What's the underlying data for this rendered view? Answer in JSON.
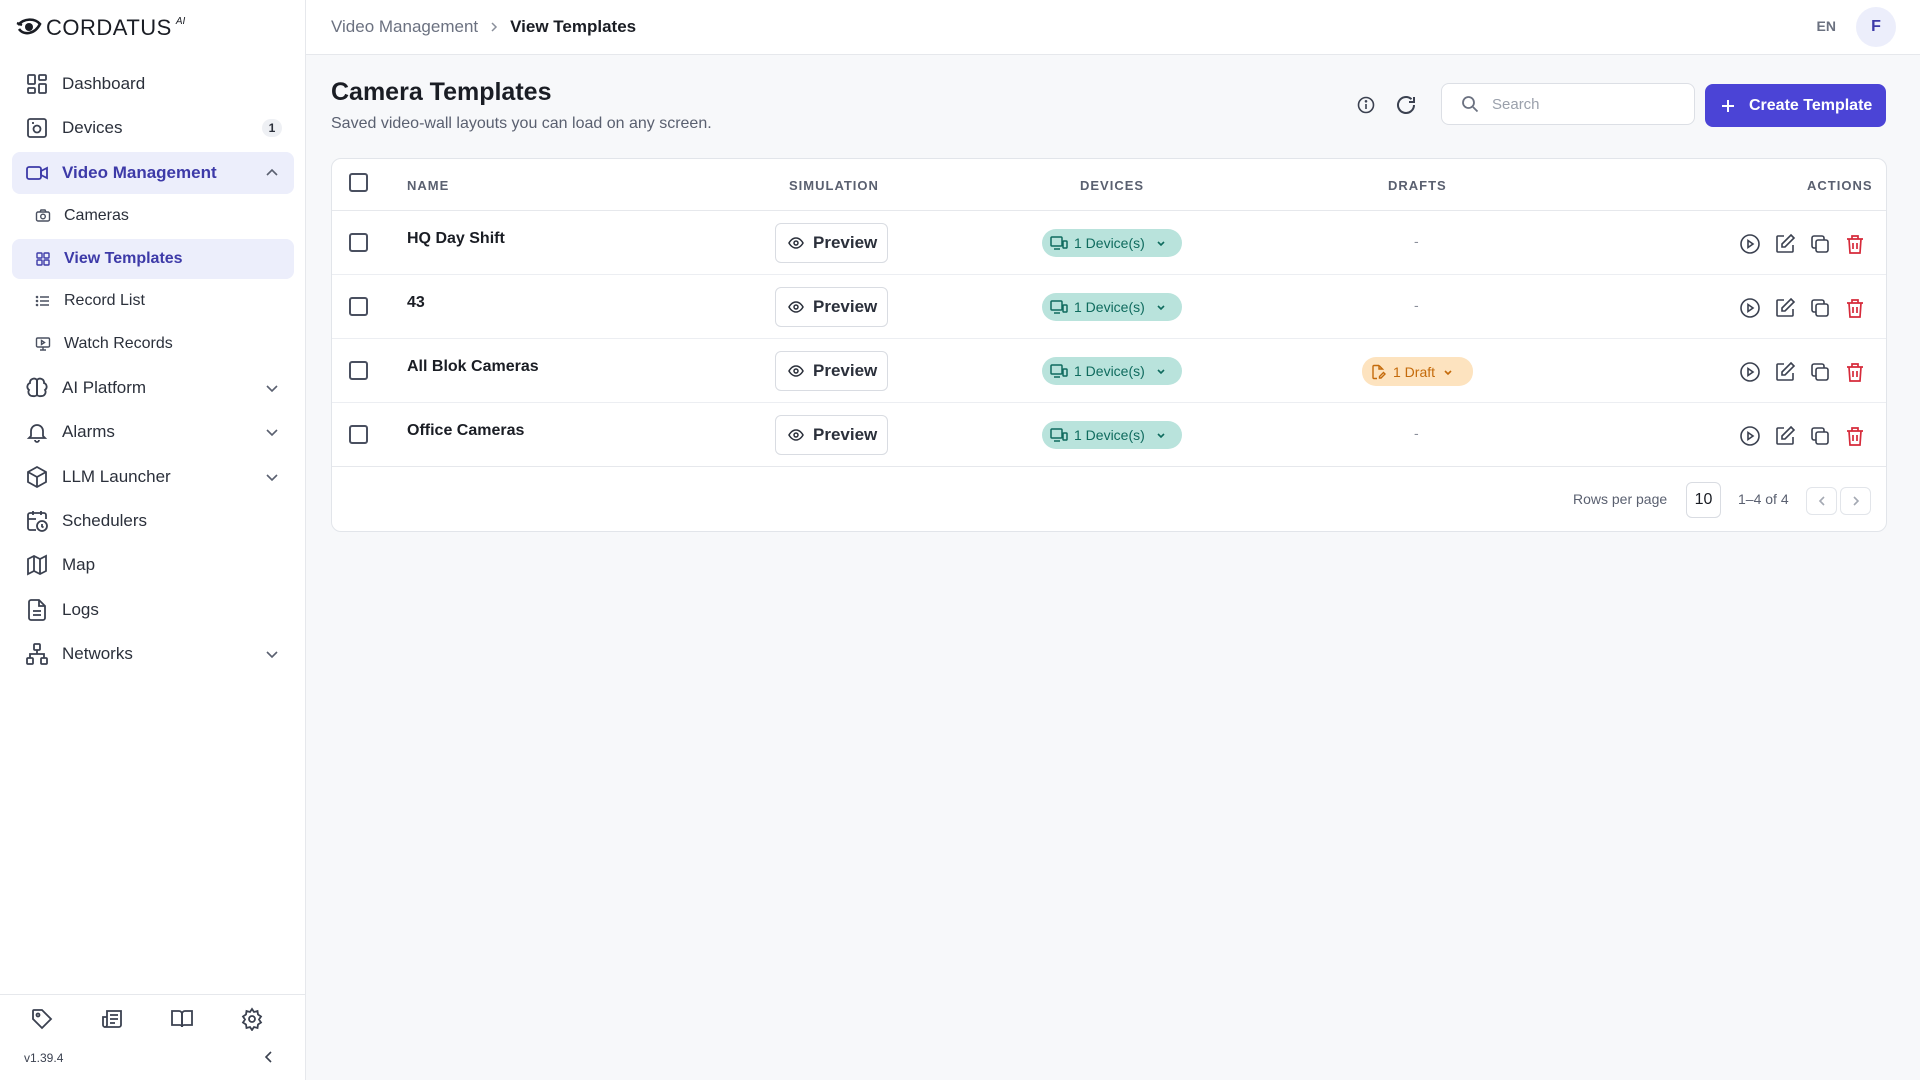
{
  "brand": {
    "name": "CORDATUS",
    "sup": "AI"
  },
  "sidebar": {
    "items": [
      {
        "label": "Dashboard"
      },
      {
        "label": "Devices",
        "badge": "1"
      },
      {
        "label": "Video Management"
      },
      {
        "label": "AI Platform"
      },
      {
        "label": "Alarms"
      },
      {
        "label": "LLM Launcher"
      },
      {
        "label": "Schedulers"
      },
      {
        "label": "Map"
      },
      {
        "label": "Logs"
      },
      {
        "label": "Networks"
      }
    ],
    "subitems": [
      {
        "label": "Cameras"
      },
      {
        "label": "View Templates"
      },
      {
        "label": "Record List"
      },
      {
        "label": "Watch Records"
      }
    ],
    "version": "v1.39.4"
  },
  "header": {
    "breadcrumb": [
      "Video Management",
      "View Templates"
    ],
    "language": "EN",
    "avatar_initial": "F"
  },
  "page": {
    "title": "Camera Templates",
    "subtitle": "Saved video-wall layouts you can load on any screen.",
    "search_placeholder": "Search",
    "create_label": "Create Template"
  },
  "table": {
    "columns": [
      "NAME",
      "SIMULATION",
      "DEVICES",
      "DRAFTS",
      "ACTIONS"
    ],
    "preview_label": "Preview",
    "rows": [
      {
        "name": "HQ Day Shift",
        "devices": "1 Device(s)",
        "drafts": "-"
      },
      {
        "name": "43",
        "devices": "1 Device(s)",
        "drafts": "-"
      },
      {
        "name": "All Blok Cameras",
        "devices": "1 Device(s)",
        "drafts": "1 Draft"
      },
      {
        "name": "Office Cameras",
        "devices": "1 Device(s)",
        "drafts": "-"
      }
    ],
    "footer": {
      "rows_per_page_label": "Rows per page",
      "rows_per_page": "10",
      "range": "1–4 of 4"
    }
  },
  "colors": {
    "accent": "#4b44d6",
    "active_text": "#3d3aa8",
    "device_chip": "#b9e3dc",
    "draft_chip": "#fde3bf",
    "danger": "#d62a3a"
  }
}
